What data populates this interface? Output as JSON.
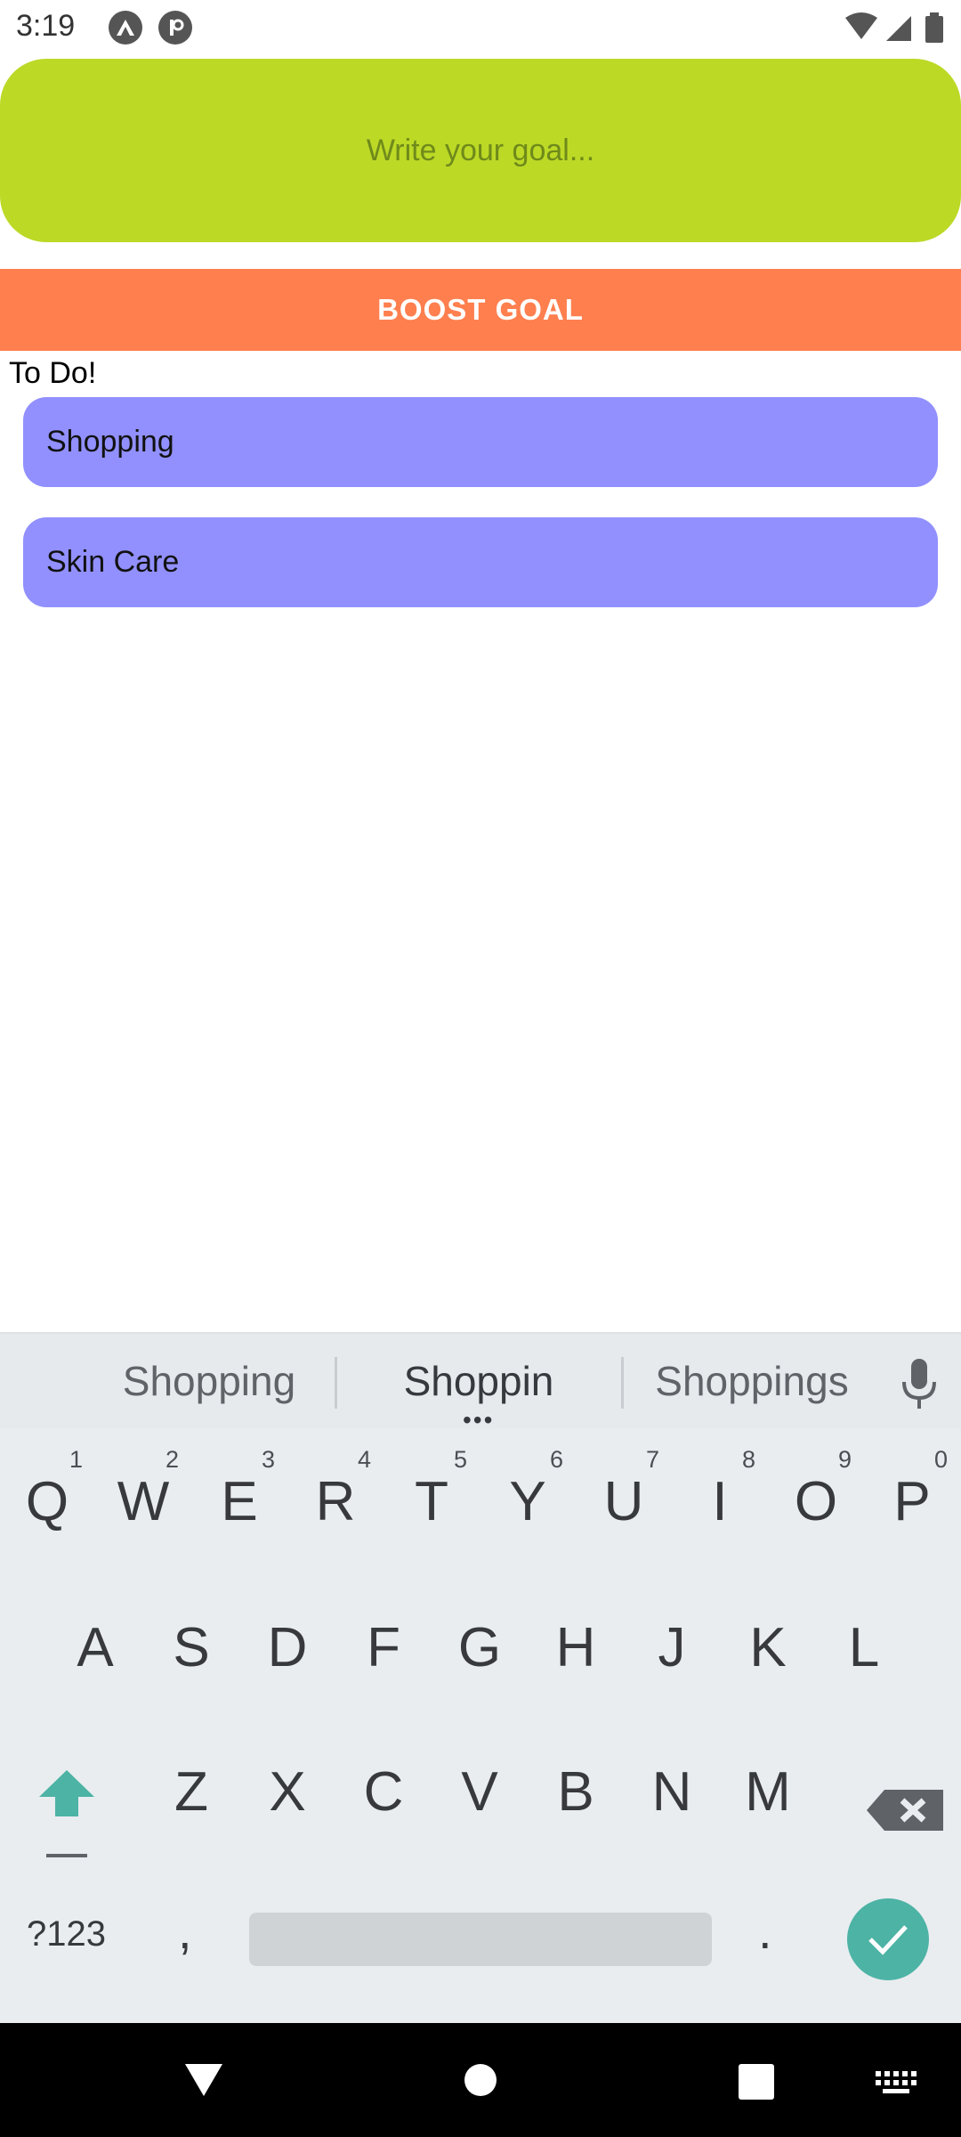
{
  "status_bar": {
    "time": "3:19",
    "left_icons": [
      "expo-icon",
      "app-icon"
    ],
    "right_icons": [
      "wifi-icon",
      "signal-icon",
      "battery-icon"
    ]
  },
  "goal_input": {
    "placeholder": "Write your goal...",
    "value": ""
  },
  "boost_button": {
    "label": "BOOST GOAL",
    "color": "#ff7f4f"
  },
  "todo": {
    "title": "To Do!",
    "items": [
      {
        "label": "Shopping"
      },
      {
        "label": "Skin Care"
      }
    ]
  },
  "colors": {
    "input_bg": "#bcd926",
    "item_bg": "#9190fe"
  },
  "keyboard": {
    "suggestions": [
      "Shopping",
      "Shoppin",
      "Shoppings"
    ],
    "row1": [
      "Q",
      "W",
      "E",
      "R",
      "T",
      "Y",
      "U",
      "I",
      "O",
      "P"
    ],
    "row1_hints": [
      "1",
      "2",
      "3",
      "4",
      "5",
      "6",
      "7",
      "8",
      "9",
      "0"
    ],
    "row2": [
      "A",
      "S",
      "D",
      "F",
      "G",
      "H",
      "J",
      "K",
      "L"
    ],
    "row3": [
      "Z",
      "X",
      "C",
      "V",
      "B",
      "N",
      "M"
    ],
    "symbols_label": "?123",
    "comma": ",",
    "period": "."
  }
}
